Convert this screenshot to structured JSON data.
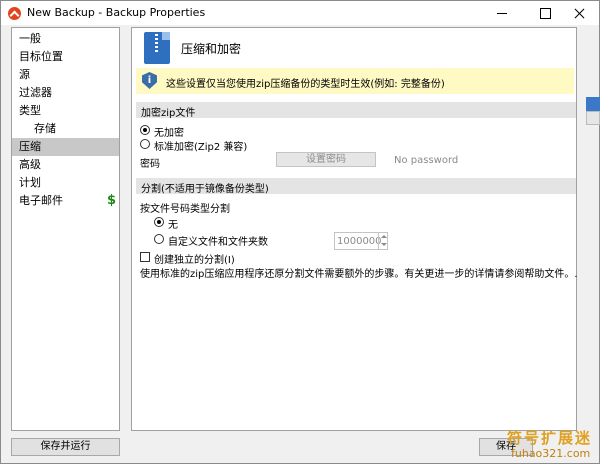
{
  "window": {
    "title": "New Backup - Backup Properties"
  },
  "sidebar": {
    "items": [
      {
        "label": "一般"
      },
      {
        "label": "目标位置"
      },
      {
        "label": "源"
      },
      {
        "label": "过滤器"
      },
      {
        "label": "类型"
      },
      {
        "label": "存储"
      },
      {
        "label": "压缩"
      },
      {
        "label": "高级"
      },
      {
        "label": "计划"
      },
      {
        "label": "电子邮件",
        "icon": "$"
      }
    ],
    "selected": "压缩"
  },
  "main": {
    "header_title": "压缩和加密",
    "info_text": "这些设置仅当您使用zip压缩备份的类型时生效(例如: 完整备份)",
    "encrypt": {
      "section_title": "加密zip文件",
      "option_none": "无加密",
      "option_standard": "标准加密(Zip2 兼容)",
      "password_label": "密码",
      "set_password_button": "设置密码",
      "password_status": "No password"
    },
    "split": {
      "section_title": "分割(不适用于镜像备份类型)",
      "by_type_label": "按文件号码类型分割",
      "option_none": "无",
      "option_custom": "自定义文件和文件夹数",
      "custom_value": "1000000",
      "create_split_label": "创建独立的分割(I)",
      "note": "使用标准的zip压缩应用程序还原分割文件需要额外的步骤。有关更进一步的详情请参阅帮助文件。."
    }
  },
  "footer": {
    "save_run_button": "保存并运行",
    "save_button": "保存"
  },
  "watermark": {
    "top": "符号扩展迷",
    "bottom": "fuhao321.com"
  },
  "colors": {
    "info_background": "#fff9c4",
    "selection": "#c8c8c8",
    "dollar": "#1a8a1a"
  }
}
